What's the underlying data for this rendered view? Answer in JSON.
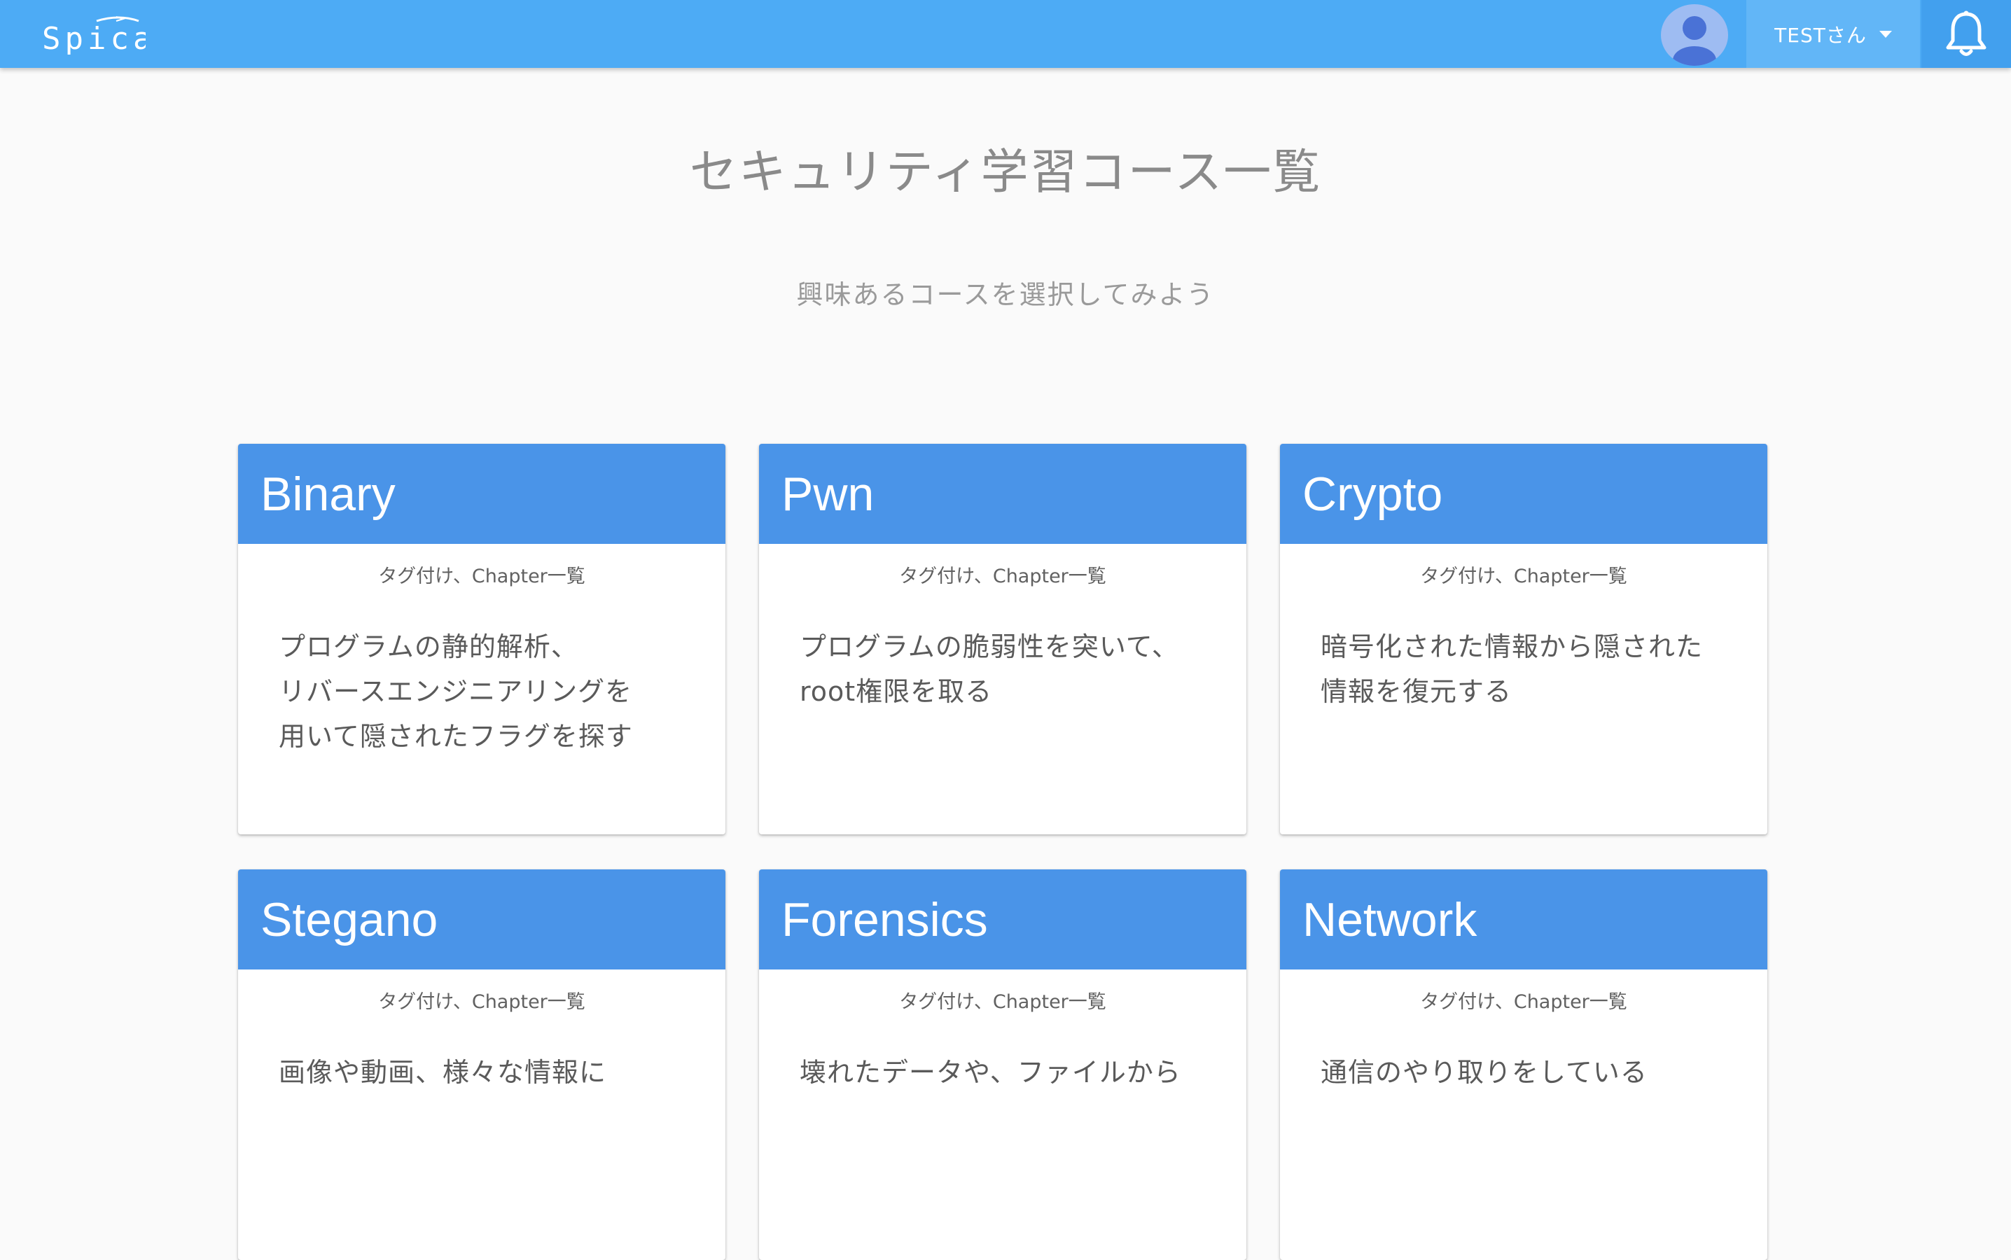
{
  "header": {
    "logo_text": "Spica",
    "user_label": "TESTさん"
  },
  "main": {
    "title": "セキュリティ学習コース一覧",
    "subtitle": "興味あるコースを選択してみよう"
  },
  "courses": [
    {
      "title": "Binary",
      "tags": "タグ付け、Chapter一覧",
      "description": "プログラムの静的解析、\nリバースエンジニアリングを\n用いて隠されたフラグを探す"
    },
    {
      "title": "Pwn",
      "tags": "タグ付け、Chapter一覧",
      "description": "プログラムの脆弱性を突いて、\nroot権限を取る"
    },
    {
      "title": "Crypto",
      "tags": "タグ付け、Chapter一覧",
      "description": "暗号化された情報から隠された\n情報を復元する"
    },
    {
      "title": "Stegano",
      "tags": "タグ付け、Chapter一覧",
      "description": "画像や動画、様々な情報に"
    },
    {
      "title": "Forensics",
      "tags": "タグ付け、Chapter一覧",
      "description": "壊れたデータや、ファイルから"
    },
    {
      "title": "Network",
      "tags": "タグ付け、Chapter一覧",
      "description": "通信のやり取りをしている"
    }
  ],
  "colors": {
    "appbar": "#4dabf5",
    "card_header": "#4a94e8",
    "avatar": "#9ebcf2",
    "avatar_figure": "#4a72d6"
  },
  "icons": [
    "spica-logo-icon",
    "user-avatar-icon",
    "caret-down-icon",
    "bell-icon"
  ]
}
